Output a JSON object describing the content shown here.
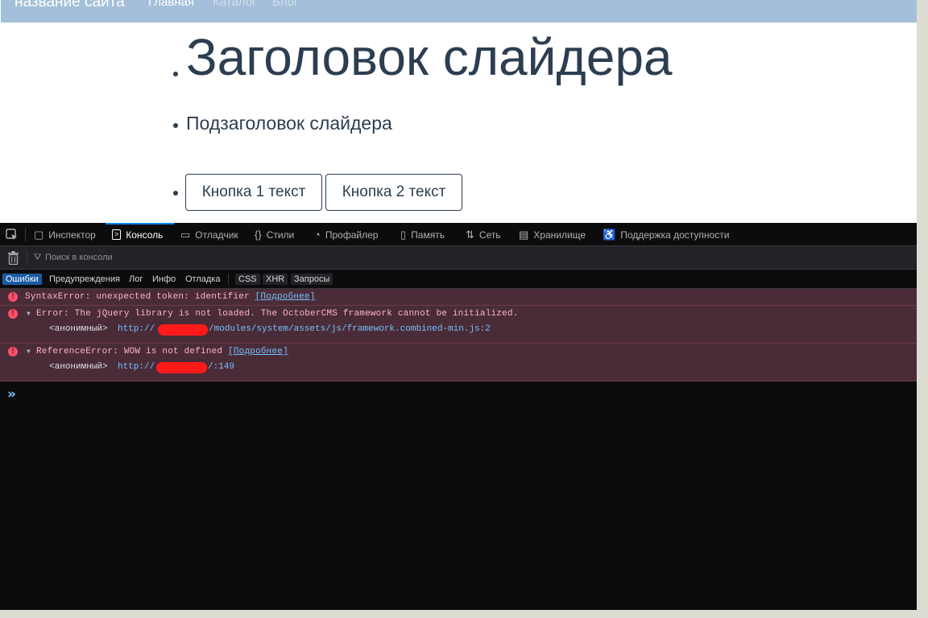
{
  "site": {
    "brand": "название сайта",
    "nav": [
      {
        "label": "Главная"
      },
      {
        "label": "Каталог"
      },
      {
        "label": "Блог"
      }
    ]
  },
  "slider": {
    "title": "Заголовок слайдера",
    "subtitle": "Подзаголовок слайдера",
    "button1": "Кнопка 1 текст",
    "button2": "Кнопка 2 текст"
  },
  "devtools": {
    "tabs": [
      {
        "label": "Инспектор",
        "icon": "inspector-icon"
      },
      {
        "label": "Консоль",
        "icon": "console-icon"
      },
      {
        "label": "Отладчик",
        "icon": "debugger-icon"
      },
      {
        "label": "Стили",
        "icon": "style-editor-icon"
      },
      {
        "label": "Профайлер",
        "icon": "profiler-icon"
      },
      {
        "label": "Память",
        "icon": "memory-icon"
      },
      {
        "label": "Сеть",
        "icon": "network-icon"
      },
      {
        "label": "Хранилище",
        "icon": "storage-icon"
      },
      {
        "label": "Поддержка доступности",
        "icon": "accessibility-icon"
      }
    ],
    "active_tab": "Консоль",
    "filter_placeholder": "Поиск в консоли",
    "levels": [
      {
        "label": "Ошибки",
        "on": true
      },
      {
        "label": "Предупреждения",
        "on": false
      },
      {
        "label": "Лог",
        "on": false
      },
      {
        "label": "Инфо",
        "on": false
      },
      {
        "label": "Отладка",
        "on": false
      },
      {
        "label": "CSS",
        "on": false
      },
      {
        "label": "XHR",
        "on": false
      },
      {
        "label": "Запросы",
        "on": false
      }
    ],
    "messages": [
      {
        "text": "SyntaxError: unexpected token: identifier",
        "learn_more": "[Подробнее]"
      },
      {
        "text": "Error: The jQuery library is not loaded. The OctoberCMS framework cannot be initialized.",
        "stack_fn": "<анонимный>",
        "url_prefix": "http://",
        "url_suffix": "/modules/system/assets/js/framework.combined-min.js:2"
      },
      {
        "text": "ReferenceError: WOW is not defined",
        "learn_more": "[Подробнее]",
        "stack_fn": "<анонимный>",
        "url_prefix": "http://",
        "url_suffix": "/:149"
      }
    ],
    "colors": {
      "accent": "#0a84ff",
      "error_bg": "#4a2c38",
      "error_text": "#ffb3c2",
      "link": "#75bfff"
    }
  }
}
